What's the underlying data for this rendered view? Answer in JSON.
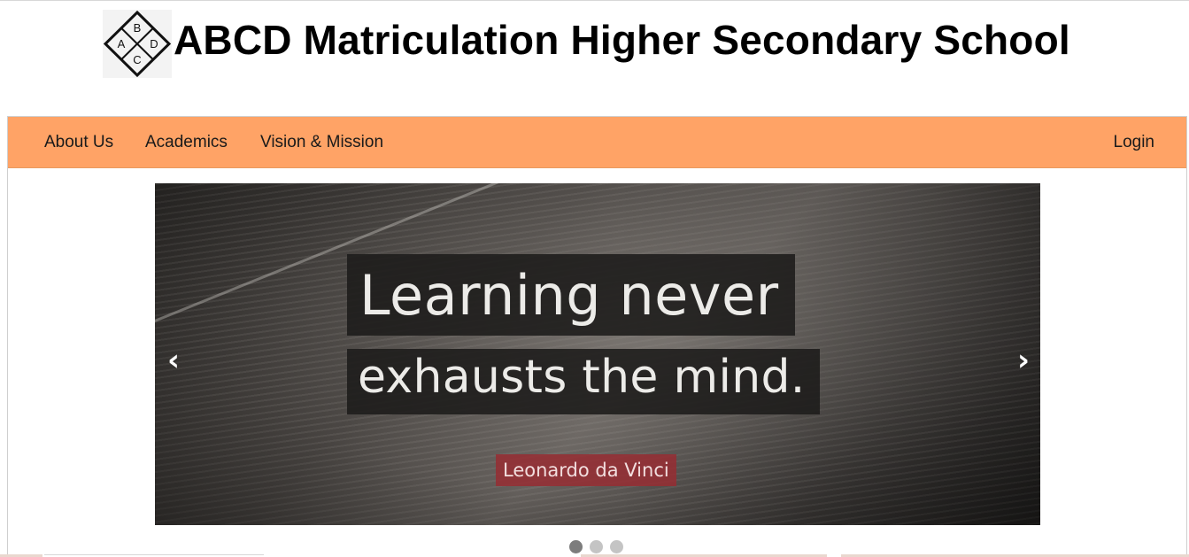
{
  "header": {
    "logo_letters": [
      "A",
      "B",
      "C",
      "D"
    ],
    "title": "ABCD Matriculation Higher Secondary School"
  },
  "nav": {
    "items": [
      {
        "label": "About Us"
      },
      {
        "label": "Academics"
      },
      {
        "label": "Vision & Mission"
      }
    ],
    "login_label": "Login",
    "background_color": "#ffa366"
  },
  "carousel": {
    "slide": {
      "quote_line1": "Learning never",
      "quote_line2": "exhausts the mind.",
      "author": "Leonardo da Vinci"
    },
    "prev_icon": "‹",
    "next_icon": "›",
    "slide_count": 3,
    "active_index": 0
  }
}
